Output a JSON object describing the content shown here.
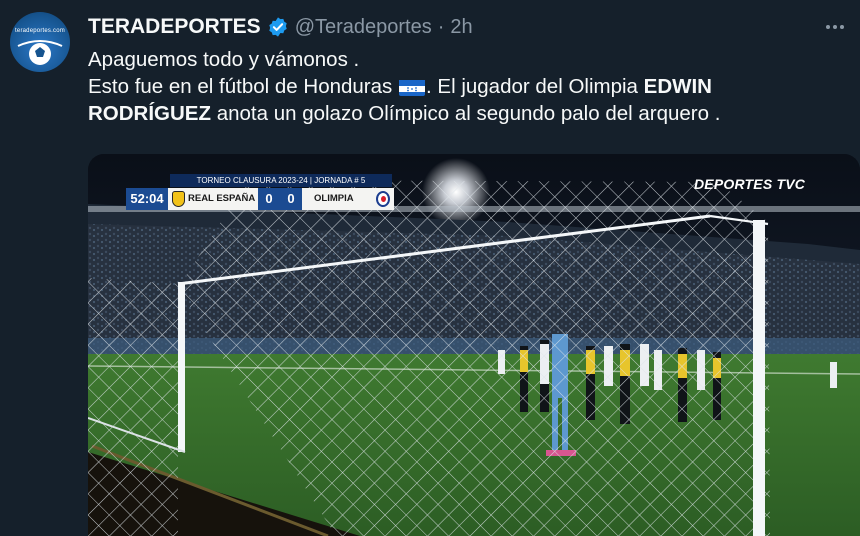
{
  "account": {
    "name": "TERADEPORTES",
    "handle": "@Teradeportes",
    "separator": "·",
    "time": "2h",
    "avatar_text": "teradeportes.com",
    "verified": true
  },
  "tweet": {
    "line1": "Apaguemos todo y vámonos .",
    "line2_before_flag": "Esto fue en el fútbol de Honduras",
    "line2_after_flag": ". El jugador del Olimpia ",
    "player_name": "EDWIN RODRÍGUEZ",
    "line3_rest": " anota un golazo Olímpico al segundo palo del arquero ."
  },
  "media": {
    "tournament": "TORNEO CLAUSURA 2023-24 | JORNADA # 5",
    "clock": "52:04",
    "home_team": "REAL ESPAÑA",
    "home_score": "0",
    "away_score": "0",
    "away_team": "OLIMPIA",
    "broadcaster": "DEPORTES TVC"
  },
  "colors": {
    "background": "#15202b",
    "verified": "#1d9bf0",
    "secondary_text": "#8b98a5",
    "scoreboard_blue": "#1b4b92"
  }
}
